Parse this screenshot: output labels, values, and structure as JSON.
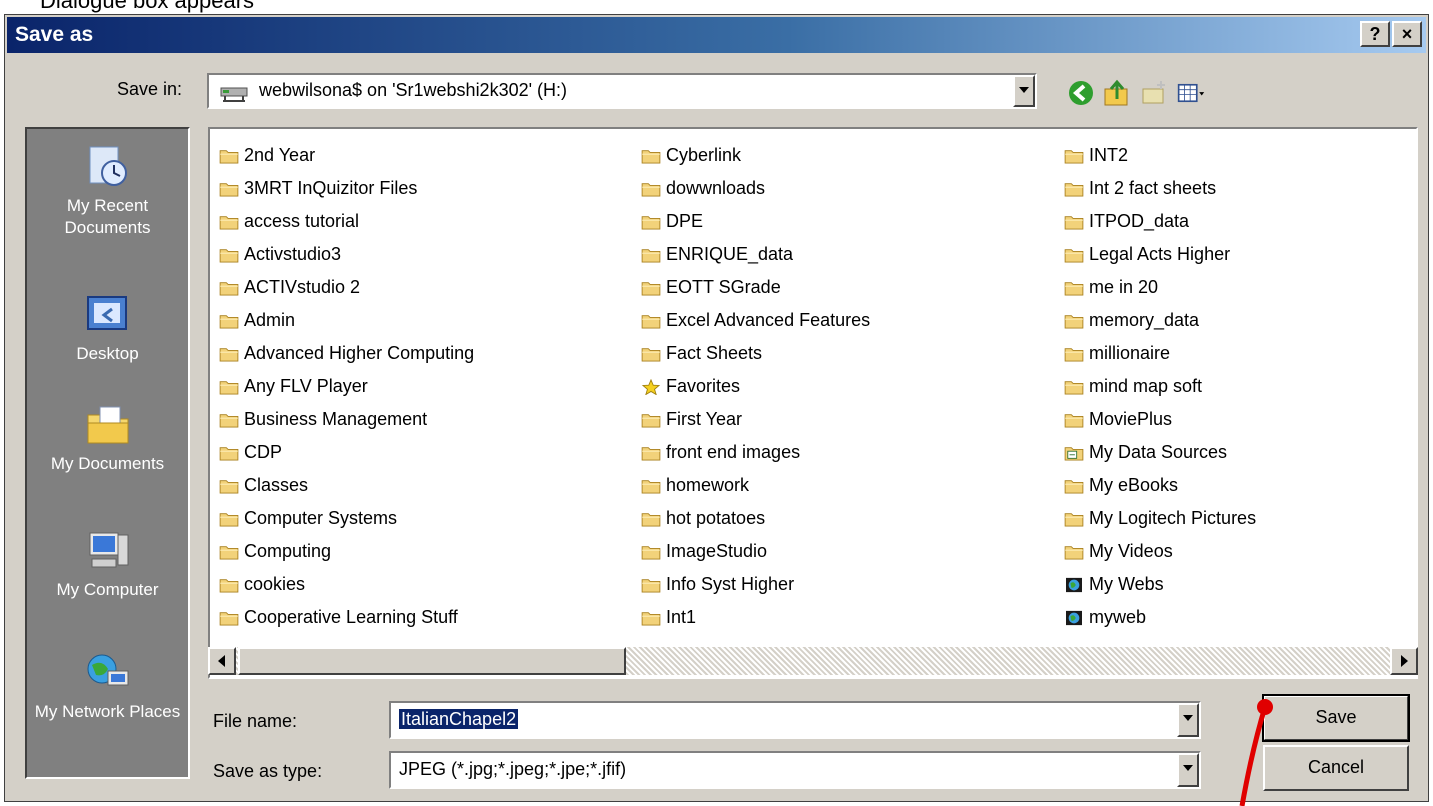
{
  "top_caption": "Dialogue box appears",
  "window": {
    "title": "Save as",
    "help_btn": "?",
    "close_btn": "×"
  },
  "save_in": {
    "label": "Save in:",
    "value": "webwilsona$ on 'Sr1webshi2k302' (H:)"
  },
  "places": [
    {
      "label": "My Recent Documents"
    },
    {
      "label": "Desktop"
    },
    {
      "label": "My Documents"
    },
    {
      "label": "My Computer"
    },
    {
      "label": "My Network Places"
    }
  ],
  "files": {
    "col1": [
      "2nd Year",
      "3MRT InQuizitor Files",
      "access tutorial",
      "Activstudio3",
      "ACTIVstudio 2",
      "Admin",
      "Advanced Higher Computing",
      "Any FLV Player",
      "Business Management",
      "CDP",
      "Classes",
      "Computer Systems",
      "Computing",
      "cookies",
      "Cooperative Learning Stuff"
    ],
    "col2": [
      "Cyberlink",
      "dowwnloads",
      "DPE",
      "ENRIQUE_data",
      "EOTT SGrade",
      "Excel Advanced Features",
      "Fact Sheets",
      "Favorites",
      "First Year",
      "front end images",
      "homework",
      "hot potatoes",
      "ImageStudio",
      "Info Syst Higher",
      "Int1"
    ],
    "col3": [
      "INT2",
      "Int 2 fact sheets",
      "ITPOD_data",
      "Legal Acts Higher",
      "me in 20",
      "memory_data",
      "millionaire",
      "mind map soft",
      "MoviePlus",
      "My Data Sources",
      "My eBooks",
      "My Logitech Pictures",
      "My Videos",
      "My Webs",
      "myweb"
    ]
  },
  "file_name": {
    "label": "File name:",
    "value": "ItalianChapel2"
  },
  "save_type": {
    "label": "Save as type:",
    "value": "JPEG (*.jpg;*.jpeg;*.jpe;*.jfif)"
  },
  "buttons": {
    "save": "Save",
    "cancel": "Cancel"
  },
  "colors": {
    "title_bar": "#0a246a",
    "dialog_bg": "#d4d0c8",
    "annotation": "#e00000"
  }
}
